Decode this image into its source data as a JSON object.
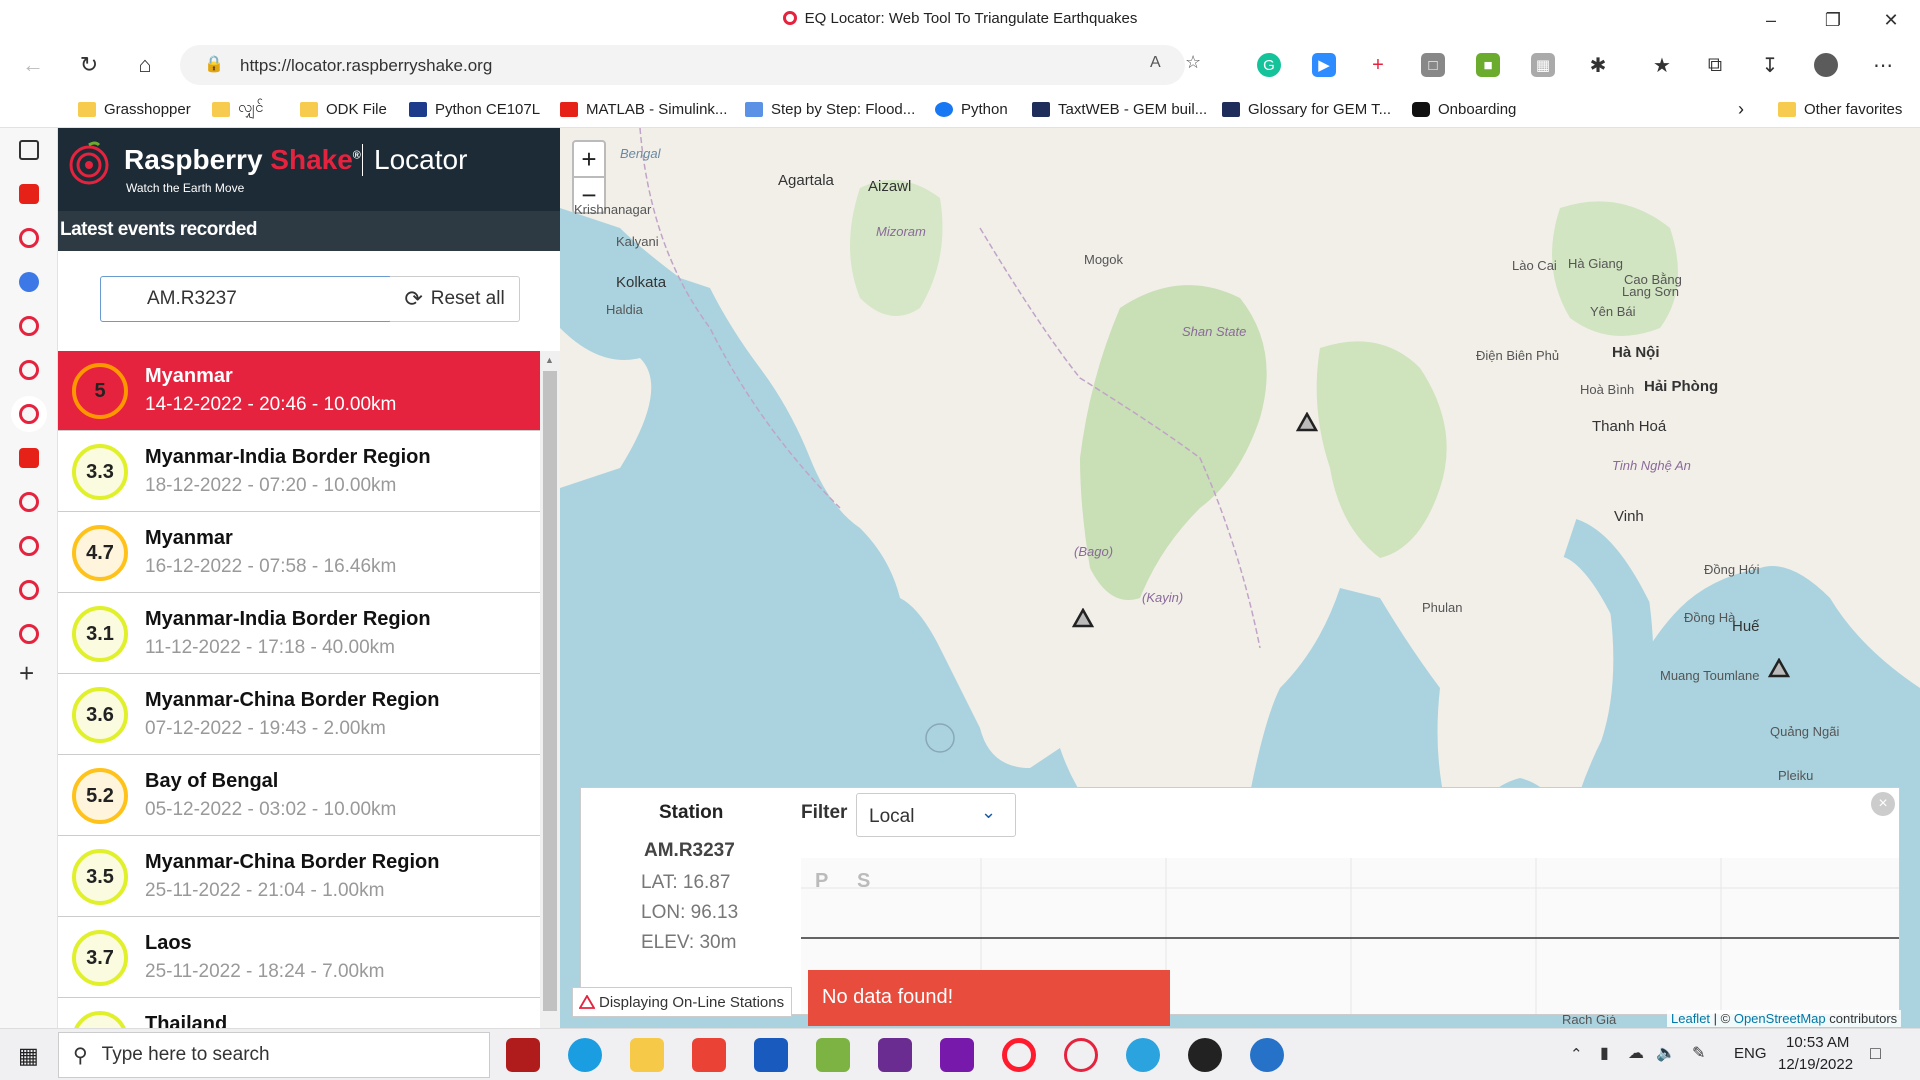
{
  "browser": {
    "title": "EQ Locator: Web Tool To Triangulate Earthquakes",
    "url": "https://locator.raspberryshake.org"
  },
  "bookmarks": [
    {
      "label": "Grasshopper",
      "icon": "folder-icon"
    },
    {
      "label": "လျှင်",
      "icon": "folder-icon"
    },
    {
      "label": "ODK File",
      "icon": "folder-icon"
    },
    {
      "label": "Python CE107L",
      "icon": "python-icon"
    },
    {
      "label": "MATLAB - Simulink...",
      "icon": "youtube-icon"
    },
    {
      "label": "Step by Step: Flood...",
      "icon": "un-icon"
    },
    {
      "label": "Python",
      "icon": "facebook-icon"
    },
    {
      "label": "TaxtWEB - GEM buil...",
      "icon": "gem-icon"
    },
    {
      "label": "Glossary for GEM T...",
      "icon": "gem-icon"
    },
    {
      "label": "Onboarding",
      "icon": "onboarding-icon"
    }
  ],
  "other_favorites": "Other favorites",
  "brand": {
    "name_part1": "Raspberry ",
    "name_part2": "Shake",
    "registered": "®",
    "tagline": "Watch the Earth Move",
    "product": "Locator",
    "accent_color": "#e5233e"
  },
  "panel": {
    "heading": "Latest events recorded",
    "station_input_value": "AM.R3237",
    "reset_label": "Reset all"
  },
  "events": [
    {
      "mag": "5",
      "title": "Myanmar",
      "sub": "14-12-2022 - 20:46 - 10.00km",
      "ring": "#ff9800",
      "fill": "#e5233e",
      "selected": true
    },
    {
      "mag": "3.3",
      "title": "Myanmar-India Border Region",
      "sub": "18-12-2022 - 07:20 - 10.00km",
      "ring": "#e0f02a",
      "fill": "#fbfbe0"
    },
    {
      "mag": "4.7",
      "title": "Myanmar",
      "sub": "16-12-2022 - 07:58 - 16.46km",
      "ring": "#ffc21a",
      "fill": "#fff4dc"
    },
    {
      "mag": "3.1",
      "title": "Myanmar-India Border Region",
      "sub": "11-12-2022 - 17:18 - 40.00km",
      "ring": "#e0f02a",
      "fill": "#fbfbe0"
    },
    {
      "mag": "3.6",
      "title": "Myanmar-China Border Region",
      "sub": "07-12-2022 - 19:43 - 2.00km",
      "ring": "#e0f02a",
      "fill": "#fbfbe0"
    },
    {
      "mag": "5.2",
      "title": "Bay of Bengal",
      "sub": "05-12-2022 - 03:02 - 10.00km",
      "ring": "#ffc21a",
      "fill": "#fff4dc"
    },
    {
      "mag": "3.5",
      "title": "Myanmar-China Border Region",
      "sub": "25-11-2022 - 21:04 - 1.00km",
      "ring": "#e0f02a",
      "fill": "#fbfbe0"
    },
    {
      "mag": "3.7",
      "title": "Laos",
      "sub": "25-11-2022 - 18:24 - 7.00km",
      "ring": "#e0f02a",
      "fill": "#fbfbe0"
    },
    {
      "mag": "",
      "title": "Thailand",
      "sub": "",
      "ring": "#e0f02a",
      "fill": "#fbfbe0"
    }
  ],
  "map": {
    "zoom_in": "+",
    "zoom_out": "−",
    "labels": [
      {
        "text": "Bengal"
      },
      {
        "text": "Agartala"
      },
      {
        "text": "Aizawl"
      },
      {
        "text": "Kolkata"
      },
      {
        "text": "Mizoram"
      },
      {
        "text": "Mogok"
      },
      {
        "text": "Shan State"
      },
      {
        "text": "Điện Biên Phủ"
      },
      {
        "text": "Hà Nội"
      },
      {
        "text": "Hải Phòng"
      },
      {
        "text": "Thanh Hoá"
      },
      {
        "text": "Vinh"
      },
      {
        "text": "Đồng Hới"
      },
      {
        "text": "Huế"
      },
      {
        "text": "Muang Toumlane"
      },
      {
        "text": "Quảng Ngãi"
      },
      {
        "text": "Pleiku"
      },
      {
        "text": "Yên Bái"
      },
      {
        "text": "Lang Sơn"
      },
      {
        "text": "Cao Bằng"
      },
      {
        "text": "Lào Cai"
      },
      {
        "text": "Hà Giang"
      },
      {
        "text": "Hoà Bình"
      },
      {
        "text": "Đồng Hà"
      },
      {
        "text": "Phulan"
      },
      {
        "text": "(Bago)"
      },
      {
        "text": "(Kayin)"
      },
      {
        "text": "Haldia"
      },
      {
        "text": "Kalyani"
      },
      {
        "text": "Krishnanagar"
      },
      {
        "text": "Rach Giá"
      },
      {
        "text": "Tinh Nghệ An"
      }
    ]
  },
  "station": {
    "heading": "Station",
    "id": "AM.R3237",
    "lat": "LAT: 16.87",
    "lon": "LON: 96.13",
    "elev": "ELEV: 30m"
  },
  "filter": {
    "label": "Filter",
    "value": "Local"
  },
  "wave_labels": {
    "p": "P",
    "s": "S"
  },
  "legend_text": "Displaying On-Line Stations",
  "nodata_text": "No data found!",
  "attribution": {
    "leaflet": "Leaflet",
    "sep": " | © ",
    "osm": "OpenStreetMap",
    "tail": " contributors"
  },
  "taskbar": {
    "search_placeholder": "Type here to search",
    "lang": "ENG",
    "time": "10:53 AM",
    "date": "12/19/2022"
  }
}
